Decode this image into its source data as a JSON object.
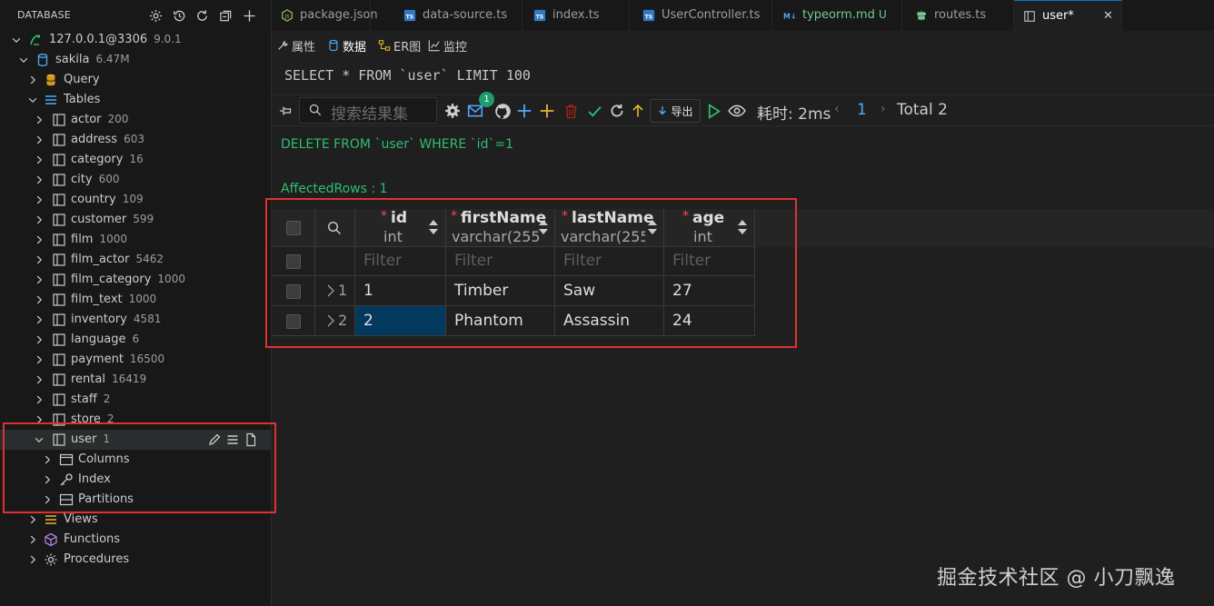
{
  "sidebar": {
    "title": "DATABASE",
    "connection": {
      "label": "127.0.0.1@3306",
      "version": "9.0.1"
    },
    "database": {
      "label": "sakila",
      "size": "6.47M"
    },
    "query": "Query",
    "tables_label": "Tables",
    "tables": [
      {
        "name": "actor",
        "count": "200"
      },
      {
        "name": "address",
        "count": "603"
      },
      {
        "name": "category",
        "count": "16"
      },
      {
        "name": "city",
        "count": "600"
      },
      {
        "name": "country",
        "count": "109"
      },
      {
        "name": "customer",
        "count": "599"
      },
      {
        "name": "film",
        "count": "1000"
      },
      {
        "name": "film_actor",
        "count": "5462"
      },
      {
        "name": "film_category",
        "count": "1000"
      },
      {
        "name": "film_text",
        "count": "1000"
      },
      {
        "name": "inventory",
        "count": "4581"
      },
      {
        "name": "language",
        "count": "6"
      },
      {
        "name": "payment",
        "count": "16500"
      },
      {
        "name": "rental",
        "count": "16419"
      },
      {
        "name": "staff",
        "count": "2"
      },
      {
        "name": "store",
        "count": "2"
      }
    ],
    "user_table": {
      "name": "user",
      "count": "1"
    },
    "user_children": [
      "Columns",
      "Index",
      "Partitions"
    ],
    "views": "Views",
    "functions": "Functions",
    "procedures": "Procedures"
  },
  "tabs": [
    {
      "label": "package.json",
      "icon": "nodejs-icon"
    },
    {
      "label": "data-source.ts",
      "icon": "typescript-icon"
    },
    {
      "label": "index.ts",
      "icon": "typescript-icon"
    },
    {
      "label": "UserController.ts",
      "icon": "typescript-icon"
    },
    {
      "label": "typeorm.md",
      "icon": "markdown-icon",
      "suffix": "U"
    },
    {
      "label": "routes.ts",
      "icon": "routes-icon"
    },
    {
      "label": "user*",
      "icon": "table-icon",
      "close": "✕"
    }
  ],
  "subtabs": {
    "props": "属性",
    "data": "数据",
    "er": "ER图",
    "monitor": "监控"
  },
  "sql": "SELECT * FROM `user` LIMIT 100",
  "toolbar": {
    "search_placeholder": "搜索结果集",
    "badge": "1",
    "export": "导出",
    "timing": "耗时: 2ms",
    "page": "1",
    "total": "Total 2",
    "prev": "‹",
    "next": "›"
  },
  "messages": {
    "delete": "DELETE FROM `user` WHERE `id`=1",
    "affected": "AffectedRows : 1"
  },
  "grid": {
    "columns": [
      {
        "name": "id",
        "type": "int"
      },
      {
        "name": "firstName",
        "type": "varchar(255"
      },
      {
        "name": "lastName",
        "type": "varchar(255"
      },
      {
        "name": "age",
        "type": "int"
      }
    ],
    "filter_placeholder": "Filter",
    "rows": [
      {
        "num": "1",
        "id": "1",
        "firstName": "Timber",
        "lastName": "Saw",
        "age": "27"
      },
      {
        "num": "2",
        "id": "2",
        "firstName": "Phantom",
        "lastName": "Assassin",
        "age": "24"
      }
    ]
  },
  "watermark": "掘金技术社区 @ 小刀飘逸",
  "colors": {
    "accent": "#0078d4",
    "success": "#2fbf71",
    "highlight": "#e03131",
    "selected_cell": "#04395e"
  }
}
